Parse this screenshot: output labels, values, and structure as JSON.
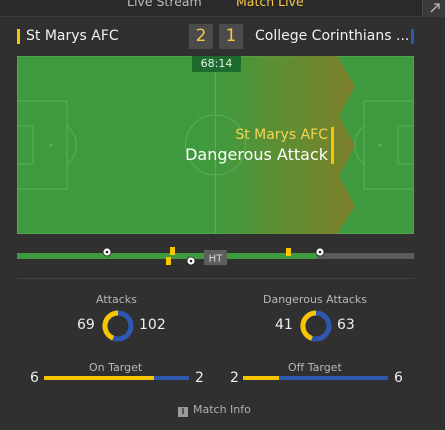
{
  "tabs": {
    "live_stream": "Live Stream",
    "match_live": "Match Live"
  },
  "match": {
    "home_team": "St Marys AFC",
    "away_team": "College Corinthians ...",
    "home_score": "2",
    "away_score": "1",
    "clock": "68:14"
  },
  "event": {
    "team": "St Marys AFC",
    "label": "Dangerous Attack"
  },
  "timeline": {
    "ht_label": "HT"
  },
  "stats": {
    "attacks": {
      "label": "Attacks",
      "home": "69",
      "away": "102"
    },
    "dangerous_attacks": {
      "label": "Dangerous Attacks",
      "home": "41",
      "away": "63"
    },
    "on_target": {
      "label": "On Target",
      "home": "6",
      "away": "2"
    },
    "off_target": {
      "label": "Off Target",
      "home": "2",
      "away": "6"
    }
  },
  "footer": {
    "label": "Match Info"
  },
  "colors": {
    "home": "#f7c600",
    "away": "#2f57b0",
    "pitch": "#3f9a3f",
    "accent": "#f7c948"
  },
  "icons": {
    "popout": "popout-icon",
    "ball": "ball-icon",
    "card": "yellow-card-icon",
    "info": "info-icon"
  }
}
